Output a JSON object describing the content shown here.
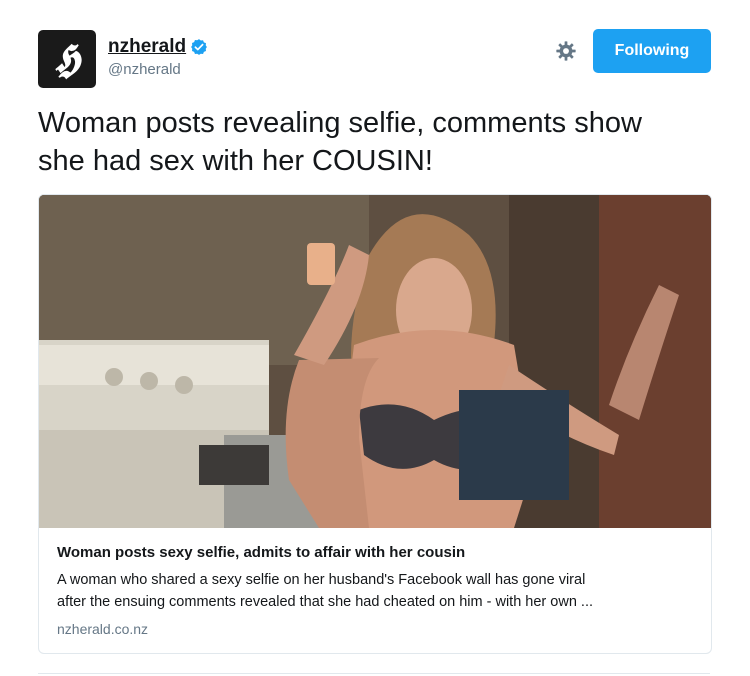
{
  "account": {
    "avatar_glyph": "𝕳",
    "display_name": "nzherald",
    "handle": "@nzherald",
    "verified_icon": "verified-badge-icon",
    "verified_color": "#1da1f2"
  },
  "actions": {
    "settings_icon": "gear-icon",
    "follow_label": "Following",
    "follow_color": "#1da1f2"
  },
  "tweet": {
    "text_line1": "Woman posts revealing selfie, comments show",
    "text_line2": "she had sex with her COUSIN!"
  },
  "card": {
    "image_alt": "mirror selfie photo",
    "title": "Woman posts sexy selfie, admits to affair with her cousin",
    "desc_line1": "A woman who shared a sexy selfie on her husband's Facebook wall has gone viral",
    "desc_line2": "after the ensuing comments revealed that she had cheated on him - with her own ...",
    "domain": "nzherald.co.nz"
  }
}
